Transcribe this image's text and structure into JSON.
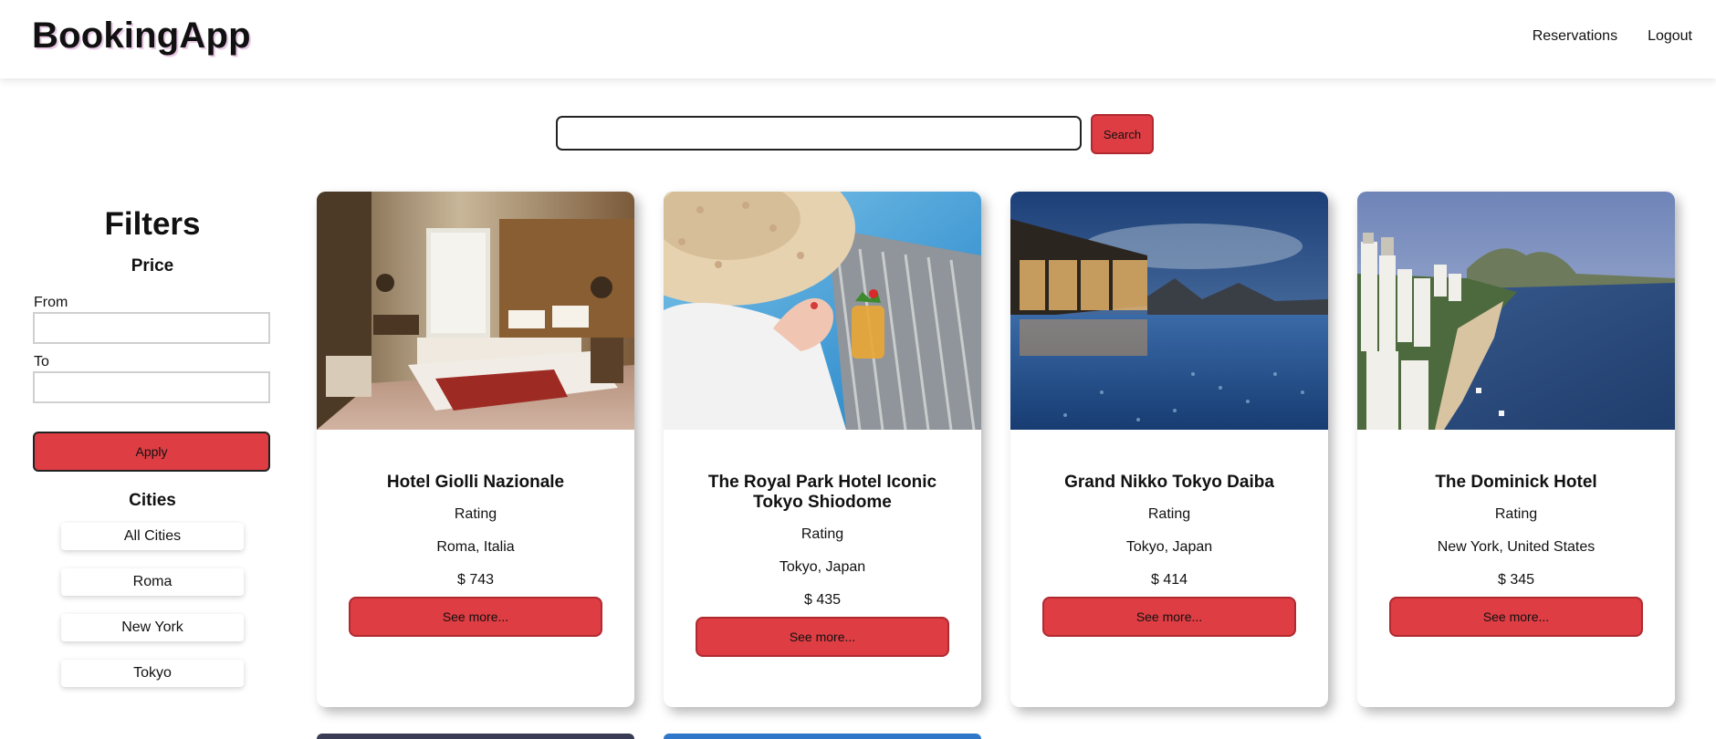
{
  "header": {
    "brand": "BookingApp",
    "nav": {
      "reservations": "Reservations",
      "logout": "Logout"
    }
  },
  "search": {
    "value": "",
    "placeholder": "",
    "button_label": "Search"
  },
  "filters": {
    "title": "Filters",
    "price": {
      "title": "Price",
      "from_label": "From",
      "to_label": "To",
      "from_value": "",
      "to_value": "",
      "apply_label": "Apply"
    },
    "cities": {
      "title": "Cities",
      "items": [
        "All Cities",
        "Roma",
        "New York",
        "Tokyo"
      ]
    }
  },
  "hotels": [
    {
      "name": "Hotel Giolli Nazionale",
      "rating_label": "Rating",
      "location": "Roma, Italia",
      "price": "$ 743",
      "button": "See more..."
    },
    {
      "name": "The Royal Park Hotel Iconic Tokyo Shiodome",
      "rating_label": "Rating",
      "location": "Tokyo, Japan",
      "price": "$ 435",
      "button": "See more..."
    },
    {
      "name": "Grand Nikko Tokyo Daiba",
      "rating_label": "Rating",
      "location": "Tokyo, Japan",
      "price": "$ 414",
      "button": "See more..."
    },
    {
      "name": "The Dominick Hotel",
      "rating_label": "Rating",
      "location": "New York, United States",
      "price": "$ 345",
      "button": "See more..."
    }
  ],
  "colors": {
    "accent": "#dd3d43",
    "accent_border": "#b02a30",
    "text": "#111111"
  }
}
